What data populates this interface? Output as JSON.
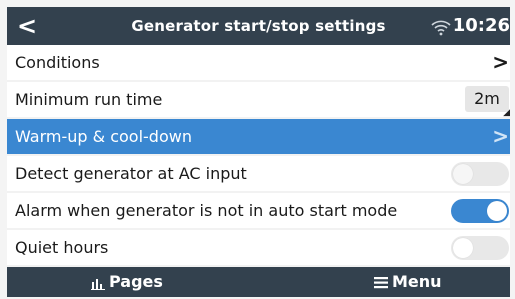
{
  "header": {
    "back_glyph": "<",
    "title": "Generator start/stop settings",
    "wifi_icon": "wifi-icon",
    "time": "10:26"
  },
  "rows": [
    {
      "label": "Conditions",
      "control": "chevron",
      "chevron": ">"
    },
    {
      "label": "Minimum run time",
      "control": "value",
      "value": "2m"
    },
    {
      "label": "Warm-up & cool-down",
      "control": "chevron",
      "chevron": ">",
      "selected": true
    },
    {
      "label": "Detect generator at AC input",
      "control": "toggle",
      "state": "off"
    },
    {
      "label": "Alarm when generator is not in auto start mode",
      "control": "toggle",
      "state": "on"
    },
    {
      "label": "Quiet hours",
      "control": "toggle",
      "state": "off"
    }
  ],
  "footer": {
    "pages_label": "Pages",
    "pages_icon": "bar-chart-icon",
    "menu_label": "Menu",
    "menu_icon": "hamburger-icon"
  },
  "colors": {
    "header_bg": "#33414e",
    "selected_bg": "#3a87d1",
    "toggle_on": "#3a87d1",
    "toggle_off": "#e8e8e8"
  }
}
